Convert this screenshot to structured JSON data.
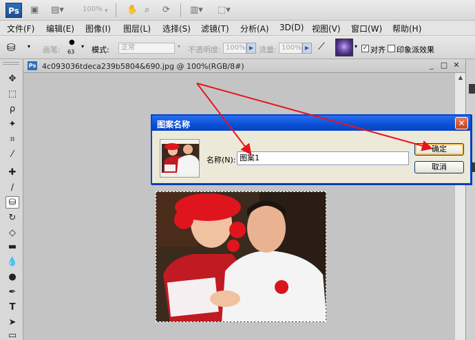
{
  "app": {
    "logo": "Ps",
    "zoom_display": "100%"
  },
  "menu": {
    "items": [
      "文件(F)",
      "编辑(E)",
      "图像(I)",
      "图层(L)",
      "选择(S)",
      "滤镜(T)",
      "分析(A)",
      "3D(D)",
      "视图(V)",
      "窗口(W)",
      "帮助(H)"
    ]
  },
  "options": {
    "brush_label": "画笔:",
    "brush_size": "63",
    "mode_label": "模式:",
    "mode_value": "正常",
    "opacity_label": "不透明度:",
    "opacity_value": "100%",
    "flow_label": "流量:",
    "flow_value": "100%",
    "aligned_label": "对齐",
    "aligned_checked": "✓",
    "impressionist_label": "印象派效果",
    "impressionist_checked": ""
  },
  "document": {
    "title": "4c093036tdeca239b5804&690.jpg @ 100%(RGB/8#)"
  },
  "dialog": {
    "title": "图案名称",
    "name_label": "名称(N):",
    "name_value": "图案1",
    "ok_label": "确定",
    "cancel_label": "取消",
    "close_icon": "close-icon"
  },
  "colors": {
    "dialog_title": "#0a4fd6",
    "annotation_arrow": "#e8141c",
    "canvas_bg": "#c4c4c4"
  }
}
